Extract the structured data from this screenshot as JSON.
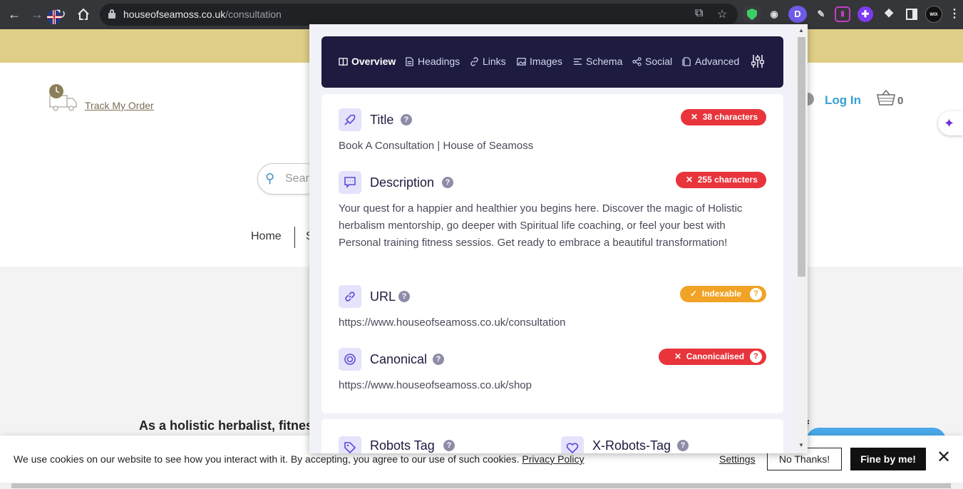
{
  "browser": {
    "url_domain": "houseofseamoss.co.uk",
    "url_path": "/consultation",
    "ext_d_label": "D",
    "ext_wix_label": "WIX"
  },
  "site": {
    "track_order": "Track My Order",
    "search_placeholder": "Searc",
    "nav_home": "Home",
    "nav_partial": "S",
    "login": "Log In",
    "cart_count": "0",
    "hero_text": "As a holistic herbalist, fitness",
    "hero_tail": "f"
  },
  "cookie": {
    "text": "We use cookies on our website to see how you interact with it. By accepting, you agree to our use of such cookies.",
    "privacy": "Privacy Policy",
    "settings": "Settings",
    "decline": "No Thanks!",
    "accept": "Fine by me!"
  },
  "popup": {
    "tabs": {
      "overview": "Overview",
      "headings": "Headings",
      "links": "Links",
      "images": "Images",
      "schema": "Schema",
      "social": "Social",
      "advanced": "Advanced"
    },
    "title": {
      "label": "Title",
      "badge": "38 characters",
      "value": "Book A Consultation | House of Seamoss"
    },
    "description": {
      "label": "Description",
      "badge": "255 characters",
      "value": "Your quest for a happier and healthier you begins here. Discover the magic of Holistic herbalism mentorship, go deeper with Spiritual life coaching, or feel your best with Personal training fitness sessios. Get ready to embrace a beautiful transformation!"
    },
    "url": {
      "label": "URL",
      "badge": "Indexable",
      "value": "https://www.houseofseamoss.co.uk/consultation"
    },
    "canonical": {
      "label": "Canonical",
      "badge": "Canonicalised",
      "value": "https://www.houseofseamoss.co.uk/shop"
    },
    "robots": {
      "label": "Robots Tag"
    },
    "xrobots": {
      "label": "X-Robots-Tag"
    }
  },
  "colors": {
    "tab_bar": "#1d1b3f",
    "badge_error": "#e8343b",
    "badge_warning": "#f0a324",
    "icon_accent": "#5b4bd6",
    "site_topbar": "#dfce86",
    "login_link": "#38a1d6"
  }
}
